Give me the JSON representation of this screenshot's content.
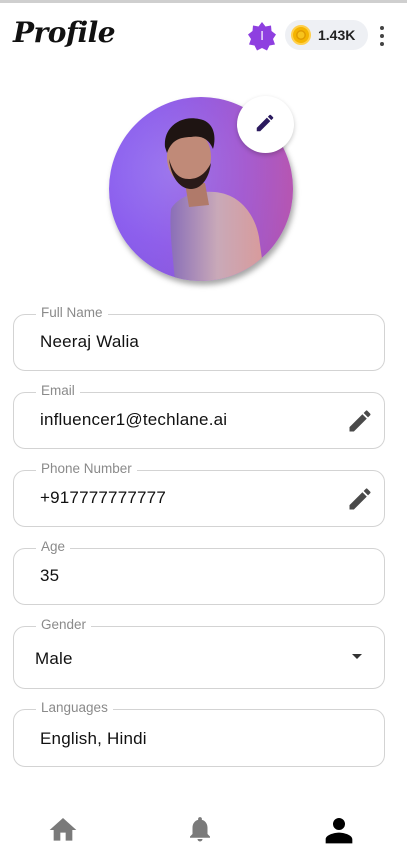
{
  "header": {
    "title": "Profile",
    "badge_letter": "I",
    "coins": "1.43K"
  },
  "profile_photo": {
    "alt": "Profile photo"
  },
  "fields": {
    "full_name": {
      "label": "Full Name",
      "value": "Neeraj Walia"
    },
    "email": {
      "label": "Email",
      "value": "influencer1@techlane.ai"
    },
    "phone": {
      "label": "Phone Number",
      "value": "+917777777777"
    },
    "age": {
      "label": "Age",
      "value": "35"
    },
    "gender": {
      "label": "Gender",
      "value": "Male"
    },
    "languages": {
      "label": "Languages",
      "value": "English, Hindi"
    }
  },
  "nav": {
    "items": [
      {
        "icon": "home-icon",
        "active": false
      },
      {
        "icon": "bell-icon",
        "active": false
      },
      {
        "icon": "person-icon",
        "active": true
      }
    ]
  },
  "colors": {
    "badge": "#8e3fe0",
    "coin": "#f4b400",
    "pencil_photo": "#2b1a5e",
    "pencil_field": "#4a4a4a",
    "nav_inactive": "#7a7a7a",
    "nav_active": "#000000"
  }
}
